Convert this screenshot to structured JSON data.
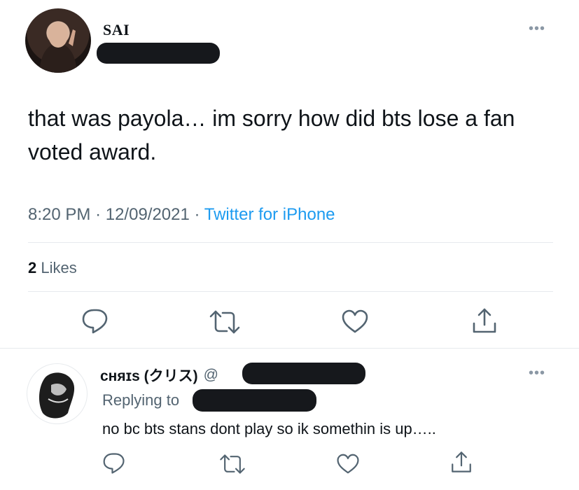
{
  "main_tweet": {
    "display_name": "SAI",
    "text": "that was payola… im sorry how did bts lose a fan voted award.",
    "time": "8:20 PM",
    "sep1": "·",
    "date": "12/09/2021",
    "sep2": "·",
    "source": "Twitter for iPhone",
    "likes_count": "2",
    "likes_label": "Likes"
  },
  "reply_tweet": {
    "display_name": "ᴄʜяɪs (クリス)",
    "handle_prefix": "@",
    "replying_label": "Replying to",
    "text": "no bc bts stans dont play so ik somethin is up….."
  },
  "icons": {
    "more": "more-horizontal-icon",
    "reply": "reply-icon",
    "retweet": "retweet-icon",
    "like": "heart-icon",
    "share": "share-icon"
  },
  "colors": {
    "link": "#1d9bf0",
    "secondary": "#536471",
    "text": "#0f1419",
    "divider": "#e7eaed"
  }
}
